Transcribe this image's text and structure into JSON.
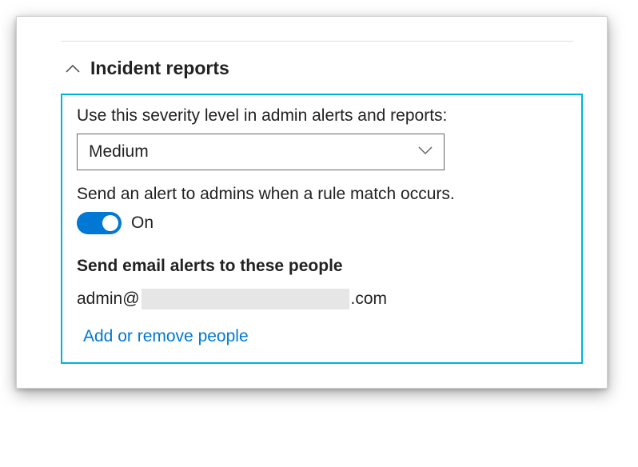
{
  "section": {
    "title": "Incident reports"
  },
  "severity": {
    "label": "Use this severity level in admin alerts and reports:",
    "value": "Medium"
  },
  "alert_toggle": {
    "label": "Send an alert to admins when a rule match occurs.",
    "state_label": "On"
  },
  "recipients": {
    "label": "Send email alerts to these people",
    "email_prefix": "admin@",
    "email_suffix": ".com"
  },
  "actions": {
    "add_remove_people": "Add or remove people"
  }
}
